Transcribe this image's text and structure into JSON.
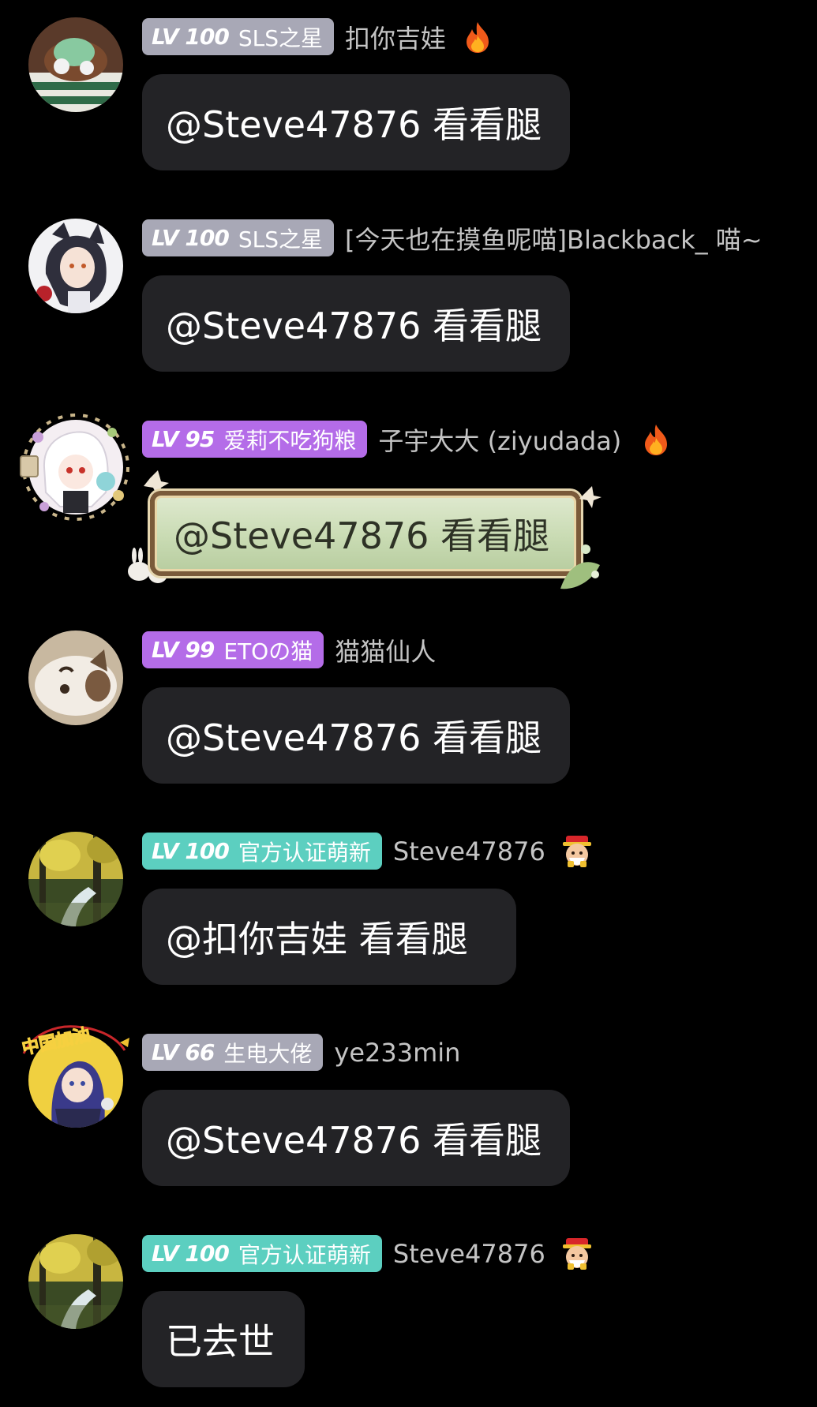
{
  "messages": [
    {
      "level": "LV 100",
      "badge": "SLS之星",
      "badge_color": "#a8a8b6",
      "username": "扣你吉娃",
      "emoji": "fire-icon",
      "text": "@Steve47876 看看腿"
    },
    {
      "level": "LV 100",
      "badge": "SLS之星",
      "badge_color": "#a8a8b6",
      "username": "[今天也在摸鱼呢喵]Blackback_ 喵~",
      "text": "@Steve47876 看看腿"
    },
    {
      "level": "LV 95",
      "badge": "爱莉不吃狗粮",
      "badge_color": "#b46ce8",
      "username": "子宇大大 (ziyudada)",
      "emoji": "fire-icon",
      "text": "@Steve47876 看看腿"
    },
    {
      "level": "LV 99",
      "badge": "ETOの猫",
      "badge_color": "#b46ce8",
      "username": "猫猫仙人",
      "text": "@Steve47876 看看腿"
    },
    {
      "level": "LV 100",
      "badge": "官方认证萌新",
      "badge_color": "#5ccfc0",
      "username": "Steve47876",
      "emoji": "fortune-god-icon",
      "text": "@扣你吉娃 看看腿"
    },
    {
      "level": "LV 66",
      "badge": "生电大佬",
      "badge_color": "#a8a8b6",
      "username": "ye233min",
      "avatar_text": "中国加油",
      "text": "@Steve47876 看看腿"
    },
    {
      "level": "LV 100",
      "badge": "官方认证萌新",
      "badge_color": "#5ccfc0",
      "username": "Steve47876",
      "emoji": "fortune-god-icon",
      "text": "已去世"
    }
  ]
}
